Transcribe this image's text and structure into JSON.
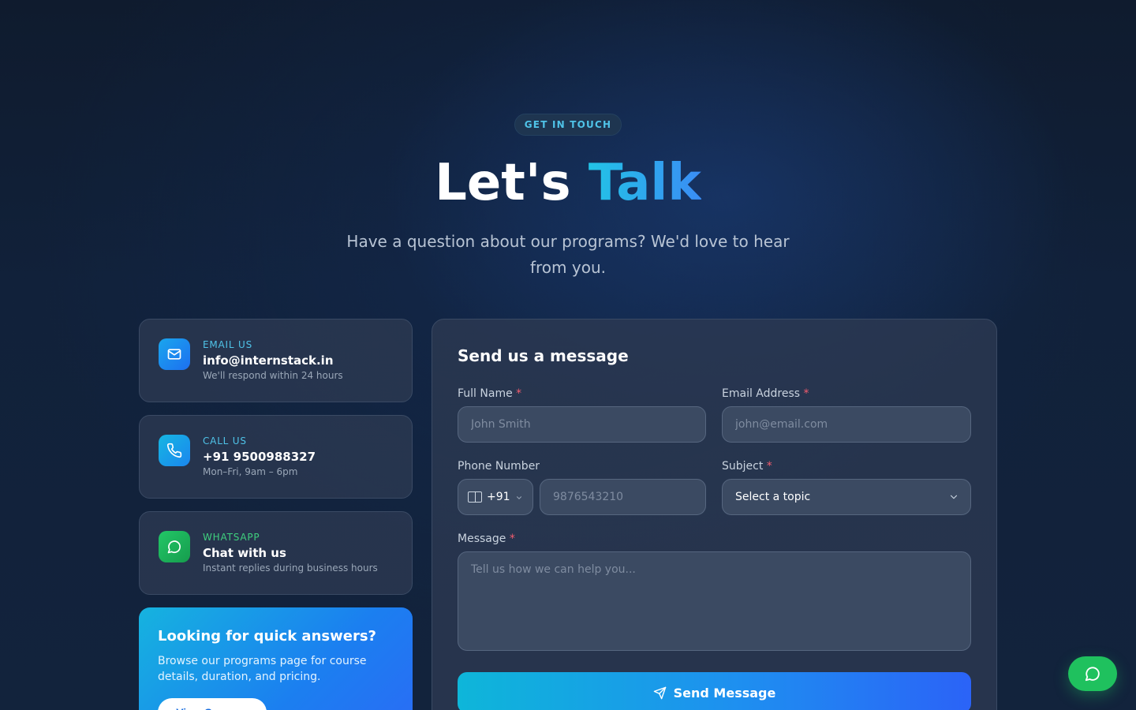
{
  "hero": {
    "badge": "GET IN TOUCH",
    "title_main": "Let's ",
    "title_accent": "Talk",
    "subtitle": "Have a question about our programs? We'd love to hear from you."
  },
  "contacts": [
    {
      "label": "EMAIL US",
      "value": "info@internstack.in",
      "note": "We'll respond within 24 hours",
      "icon": "mail-icon",
      "label_color": "#4fc3e8",
      "icon_bg": "#1a8ff0"
    },
    {
      "label": "CALL US",
      "value": "+91 9500988327",
      "note": "Mon–Fri, 9am – 6pm",
      "icon": "phone-icon",
      "label_color": "#4fc3e8",
      "icon_bg": "#13a6e6"
    },
    {
      "label": "WHATSAPP",
      "value": "Chat with us",
      "note": "Instant replies during business hours",
      "icon": "whatsapp-icon",
      "label_color": "#3fcf7e",
      "icon_bg": "#1fb45a"
    }
  ],
  "promo": {
    "heading": "Looking for quick answers?",
    "body": "Browse our programs page for course details, duration, and pricing.",
    "button": "View Courses"
  },
  "form": {
    "heading": "Send us a message",
    "required_mark": "*",
    "full_name": {
      "label": "Full Name",
      "placeholder": "John Smith"
    },
    "email": {
      "label": "Email Address",
      "placeholder": "john@email.com"
    },
    "phone": {
      "label": "Phone Number",
      "country_code": "+91",
      "placeholder": "9876543210"
    },
    "subject": {
      "label": "Subject",
      "value": "Select a topic"
    },
    "message": {
      "label": "Message",
      "placeholder": "Tell us how we can help you..."
    },
    "submit": "Send Message"
  },
  "colors": {
    "accent": "#22c3e6",
    "primary_blue": "#2b63f7",
    "whatsapp_green": "#1fc15e",
    "required": "#f25c6e"
  }
}
